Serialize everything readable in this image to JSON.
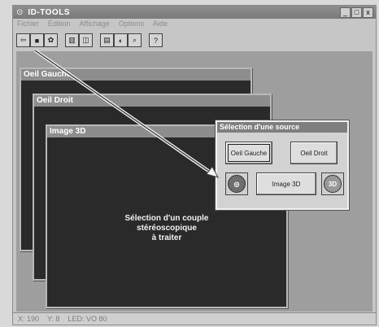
{
  "app": {
    "title": "ID-TOOLS",
    "menu": [
      "Fichier",
      "Edition",
      "Affichage",
      "Options",
      "Aide"
    ],
    "controls": [
      "_",
      "□",
      "x"
    ],
    "status": [
      "X: 190",
      "Y: 8",
      "LED: VO 80"
    ]
  },
  "windows": {
    "oeil_gauche": "Oeil Gauche",
    "oeil_droit": "Oeil Droit",
    "image_3d": "Image 3D"
  },
  "center_message": {
    "line1": "Sélection d'un couple",
    "line2": "stéréoscopique",
    "line3": "à traiter"
  },
  "dialog": {
    "title": "Sélection d'une source",
    "btn_left": "Oeil Gauche",
    "btn_right": "Oeil Droit",
    "btn_center": "Image 3D",
    "icon_left": "sphere-icon",
    "icon_right": "3d-icon",
    "icon_right_text": "3D"
  },
  "icons": [
    "open-icon",
    "save-icon",
    "gear-icon",
    "left-view-icon",
    "right-view-icon",
    "image-icon",
    "mask-icon",
    "zoom-icon",
    "help-icon"
  ]
}
